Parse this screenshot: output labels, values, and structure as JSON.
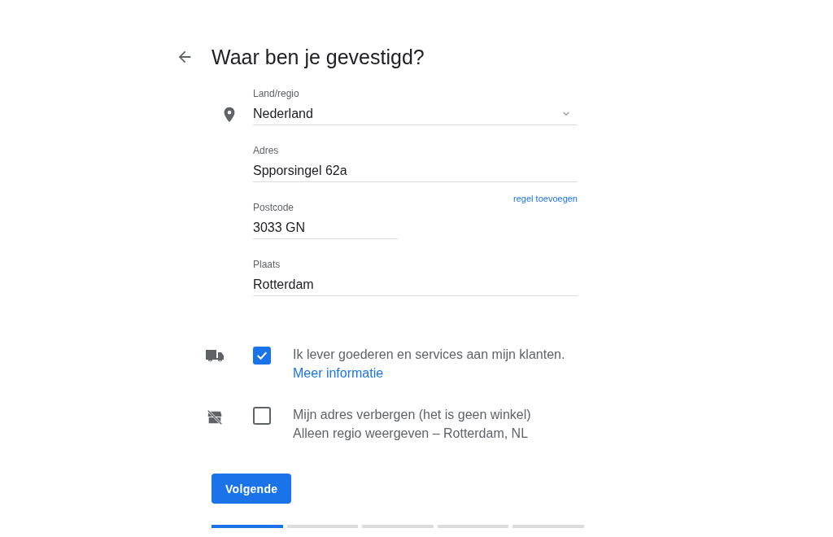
{
  "title": "Waar ben je gevestigd?",
  "fields": [
    {
      "kind": "select",
      "label": "Land/regio",
      "value": "Nederland"
    },
    {
      "kind": "text",
      "label": "Adres",
      "value": "Spporsingel 62a"
    },
    {
      "kind": "short",
      "label": "Postcode",
      "value": "3033 GN",
      "link": "regel toevoegen"
    },
    {
      "kind": "text",
      "label": "Plaats",
      "value": "Rotterdam"
    }
  ],
  "options": [
    {
      "checked": true,
      "lines": [
        "Ik lever goederen en services aan mijn klanten."
      ],
      "link": "Meer informatie"
    },
    {
      "checked": false,
      "lines": [
        "Mijn adres verbergen (het is geen winkel)",
        "Alleen regio weergeven – Rotterdam, NL"
      ]
    }
  ],
  "button": "Volgende",
  "steps": [
    {
      "selected": true
    },
    {
      "selected": false
    },
    {
      "selected": false
    },
    {
      "selected": false
    },
    {
      "selected": false
    }
  ]
}
